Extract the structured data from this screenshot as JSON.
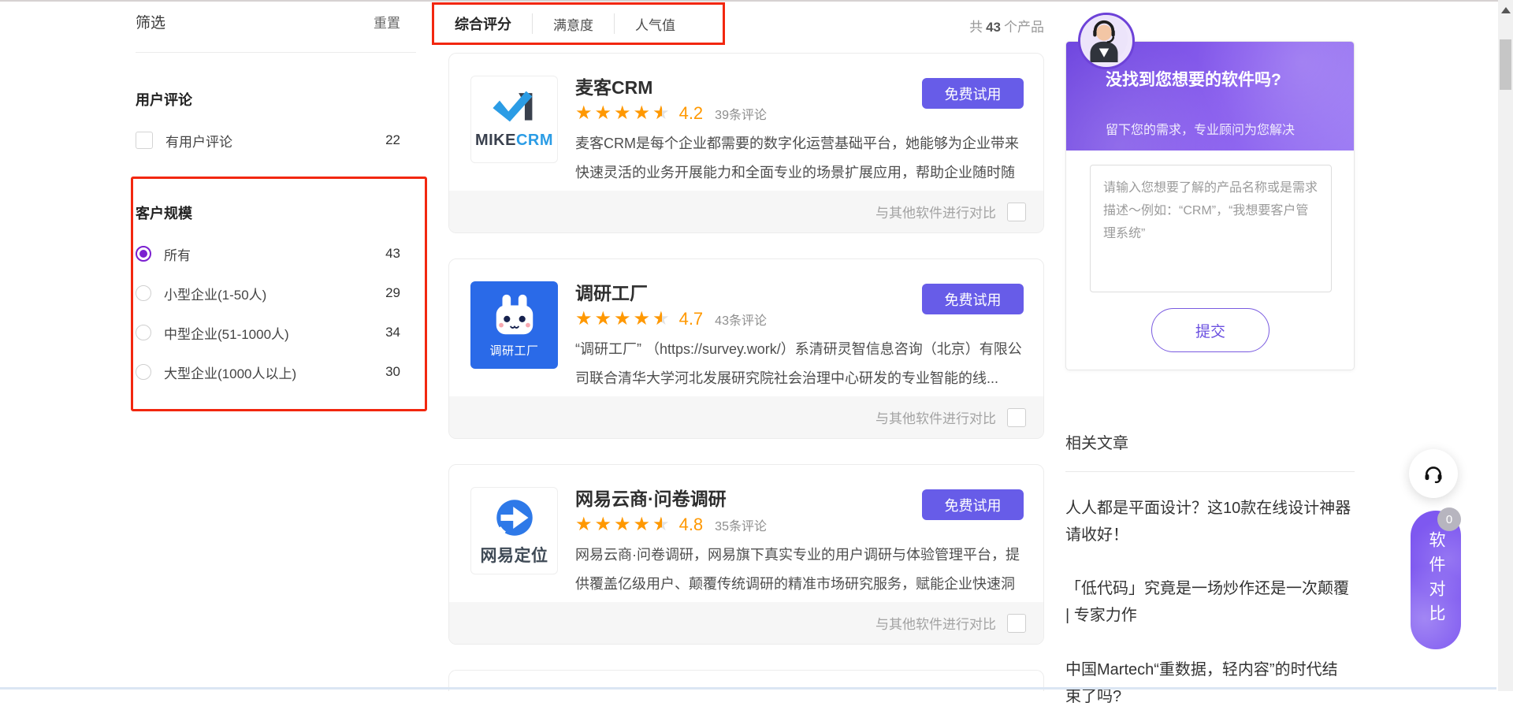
{
  "page": {
    "total_prefix": "共",
    "total_count": "43",
    "total_suffix": "个产品"
  },
  "filter": {
    "title": "筛选",
    "reset": "重置",
    "sections": [
      {
        "title": "用户评论",
        "type": "checkbox",
        "options": [
          {
            "label": "有用户评论",
            "count": "22",
            "checked": false
          }
        ]
      },
      {
        "title": "客户规模",
        "type": "radio",
        "highlighted": true,
        "options": [
          {
            "label": "所有",
            "count": "43",
            "selected": true
          },
          {
            "label": "小型企业(1-50人)",
            "count": "29",
            "selected": false
          },
          {
            "label": "中型企业(51-1000人)",
            "count": "34",
            "selected": false
          },
          {
            "label": "大型企业(1000人以上)",
            "count": "30",
            "selected": false
          }
        ]
      }
    ]
  },
  "tabs": [
    {
      "label": "综合评分",
      "active": true
    },
    {
      "label": "满意度",
      "active": false
    },
    {
      "label": "人气值",
      "active": false
    }
  ],
  "products": [
    {
      "name": "麦客CRM",
      "rating": "4.2",
      "reviews": "39条评论",
      "description": "麦客CRM是每个企业都需要的数字化运营基础平台，她能够为企业带来快速灵活的业务开展能力和全面专业的场景扩展应用，帮助企业随时随地...",
      "cta": "免费试用",
      "compare_label": "与其他软件进行对比",
      "logo": {
        "text_primary": "MIKE",
        "text_accent": "CRM"
      }
    },
    {
      "name": "调研工厂",
      "rating": "4.7",
      "reviews": "43条评论",
      "description": "“调研工厂” （https://survey.work/）系清研灵智信息咨询（北京）有限公司联合清华大学河北发展研究院社会治理中心研发的专业智能的线...",
      "cta": "免费试用",
      "compare_label": "与其他软件进行对比",
      "logo": {
        "text": "调研工厂"
      }
    },
    {
      "name": "网易云商·问卷调研",
      "rating": "4.8",
      "reviews": "35条评论",
      "description": "网易云商·问卷调研，网易旗下真实专业的用户调研与体验管理平台，提供覆盖亿级用户、颠覆传统调研的精准市场研究服务，赋能企业快速洞察...",
      "cta": "免费试用",
      "compare_label": "与其他软件进行对比",
      "logo": {
        "text": "网易定位"
      }
    }
  ],
  "request_card": {
    "title": "没找到您想要的软件吗?",
    "subtitle": "留下您的需求，专业顾问为您解决",
    "placeholder": "请输入您想要了解的产品名称或是需求描述～例如：“CRM”，“我想要客户管理系统”",
    "submit": "提交"
  },
  "articles": {
    "title": "相关文章",
    "items": [
      "人人都是平面设计？这10款在线设计神器请收好！",
      "「低代码」究竟是一场炒作还是一次颠覆 | 专家力作",
      "中国Martech“重数据，轻内容”的时代结束了吗?"
    ]
  },
  "floating": {
    "compare_label": "软件对比",
    "compare_badge": "0"
  },
  "icons": {
    "headset": "headset-icon",
    "stars": "star-icon",
    "avatar": "support-agent-avatar"
  },
  "colors": {
    "accent_purple": "#675ce8",
    "annotation_red": "#f2270f",
    "star_orange": "#ff9800",
    "radio_selected_purple": "#7b20d0",
    "header_gradient_start": "#6f46df",
    "header_gradient_end": "#9d7cf4",
    "compare_bar_bg": "#f6f6f6"
  }
}
